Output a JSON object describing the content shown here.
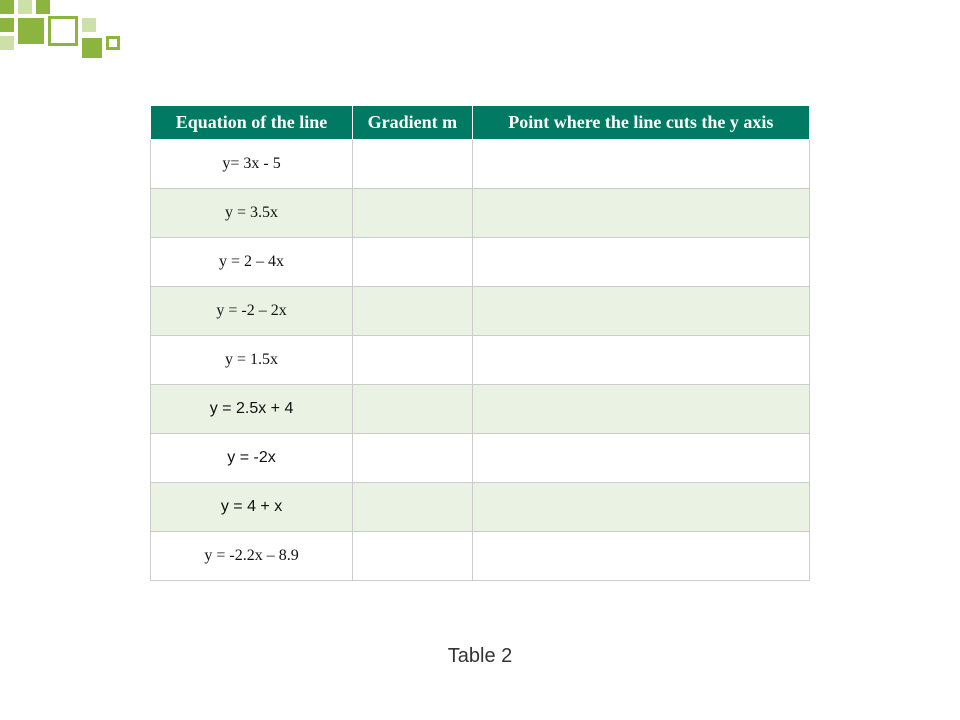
{
  "colors": {
    "accent": "#8cb53f",
    "header_bg": "#007a62",
    "row_even": "#eaf3e3"
  },
  "table": {
    "headers": [
      "Equation of the line",
      "Gradient m",
      "Point where the line cuts the y axis"
    ],
    "rows": [
      {
        "equation": "y= 3x - 5",
        "gradient": "",
        "y_intercept": "",
        "font": "serif"
      },
      {
        "equation": "y = 3.5x",
        "gradient": "",
        "y_intercept": "",
        "font": "serif"
      },
      {
        "equation": "y = 2 – 4x",
        "gradient": "",
        "y_intercept": "",
        "font": "serif"
      },
      {
        "equation": "y = -2 – 2x",
        "gradient": "",
        "y_intercept": "",
        "font": "serif"
      },
      {
        "equation": "y = 1.5x",
        "gradient": "",
        "y_intercept": "",
        "font": "serif"
      },
      {
        "equation": "y = 2.5x + 4",
        "gradient": "",
        "y_intercept": "",
        "font": "arial"
      },
      {
        "equation": "y = -2x",
        "gradient": "",
        "y_intercept": "",
        "font": "arial"
      },
      {
        "equation": "y = 4 + x",
        "gradient": "",
        "y_intercept": "",
        "font": "arial"
      },
      {
        "equation": "y = -2.2x – 8.9",
        "gradient": "",
        "y_intercept": "",
        "font": "serif"
      }
    ]
  },
  "caption": "Table 2"
}
